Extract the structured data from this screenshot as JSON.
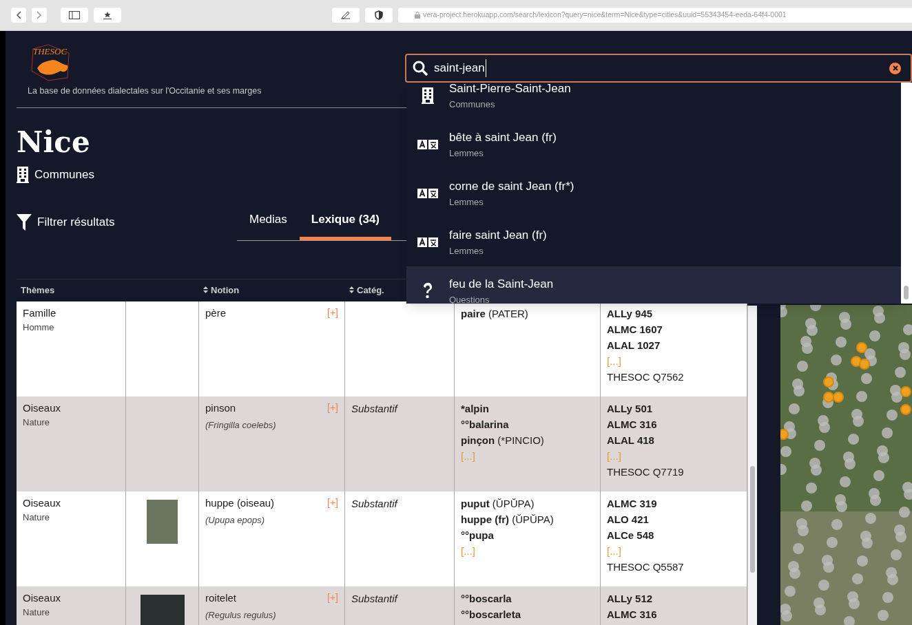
{
  "browser": {
    "url": "vera-project.herokuapp.com/search/lexicon?query=nice&term=Nice&type=cities&uuid=55343454-eeda-64f4-0001"
  },
  "header": {
    "logo_text": "THESOC",
    "tagline": "La base de données dialectales sur l'Occitanie et ses marges"
  },
  "place": {
    "title": "Nice",
    "type": "Communes"
  },
  "filter": {
    "label": "Filtrer résultats"
  },
  "tabs": [
    {
      "label": "Medias",
      "selected": false
    },
    {
      "label": "Lexique (34)",
      "selected": true
    }
  ],
  "search": {
    "value": "saint-jean",
    "results": [
      {
        "kind": "commune",
        "title": "Saint-Pierre-Saint-Jean",
        "category": "Communes",
        "selected": false
      },
      {
        "kind": "lemma",
        "title": "bête à saint Jean (fr)",
        "category": "Lemmes",
        "selected": false
      },
      {
        "kind": "lemma",
        "title": "corne de saint Jean (fr*)",
        "category": "Lemmes",
        "selected": false
      },
      {
        "kind": "lemma",
        "title": "faire saint Jean (fr)",
        "category": "Lemmes",
        "selected": false
      },
      {
        "kind": "question",
        "title": "feu de la Saint-Jean",
        "category": "Questions",
        "selected": true
      }
    ]
  },
  "table": {
    "columns": [
      {
        "kind": "text",
        "label": "Thèmes",
        "sortable": false
      },
      {
        "kind": "photo"
      },
      {
        "kind": "text",
        "label": "Notion",
        "sortable": true
      },
      {
        "kind": "text",
        "label": "Catég.",
        "sortable": true
      }
    ],
    "rows": [
      {
        "theme": "Famille",
        "subtheme": "Homme",
        "photo": false,
        "notion": "père",
        "more": "[+]",
        "category": "",
        "lemmas": [
          {
            "word": "paire",
            "etymon": "(PATER)"
          }
        ],
        "lemmas_more": "",
        "sources": [
          "ALLy 945",
          "ALMC 1607",
          "ALAL 1027"
        ],
        "sources_more": "[...]",
        "thesoc": "THESOC Q7562"
      },
      {
        "theme": "Oiseaux",
        "subtheme": "Nature",
        "photo": false,
        "notion": "pinson",
        "more": "[+]",
        "latin": "(Fringilla coelebs)",
        "category": "Substantif",
        "lemmas": [
          {
            "word": "*alpin"
          },
          {
            "word": "°°balarina"
          },
          {
            "word": "pinçon",
            "etymon": "(*PINCIO)"
          }
        ],
        "lemmas_more": "[...]",
        "sources": [
          "ALLy 501",
          "ALMC 316",
          "ALAL 418"
        ],
        "sources_more": "[...]",
        "thesoc": "THESOC Q7719"
      },
      {
        "theme": "Oiseaux",
        "subtheme": "Nature",
        "photo": true,
        "photo_wide": false,
        "notion": "huppe (oiseau)",
        "more": "[+]",
        "latin": "(Upupa epops)",
        "category": "Substantif",
        "lemmas": [
          {
            "word": "puput",
            "etymon": "(ŬPŬPA)"
          },
          {
            "word": "huppe (fr)",
            "etymon": "(ŬPŬPA)"
          },
          {
            "word": "°°pupa"
          }
        ],
        "lemmas_more": "[...]",
        "sources": [
          "ALMC 319",
          "ALO 421",
          "ALCe 548"
        ],
        "sources_more": "[...]",
        "thesoc": "THESOC Q5587"
      },
      {
        "theme": "Oiseaux",
        "subtheme": "Nature",
        "photo": true,
        "photo_wide": true,
        "notion": "roitelet",
        "more": "[+]",
        "latin": "(Regulus regulus)",
        "category": "Substantif",
        "lemmas": [
          {
            "word": "°°boscarla"
          },
          {
            "word": "°°boscarleta"
          }
        ],
        "lemmas_more": "",
        "sources": [
          "ALLy 512",
          "ALMC 316"
        ],
        "sources_more": "",
        "thesoc": ""
      }
    ]
  }
}
